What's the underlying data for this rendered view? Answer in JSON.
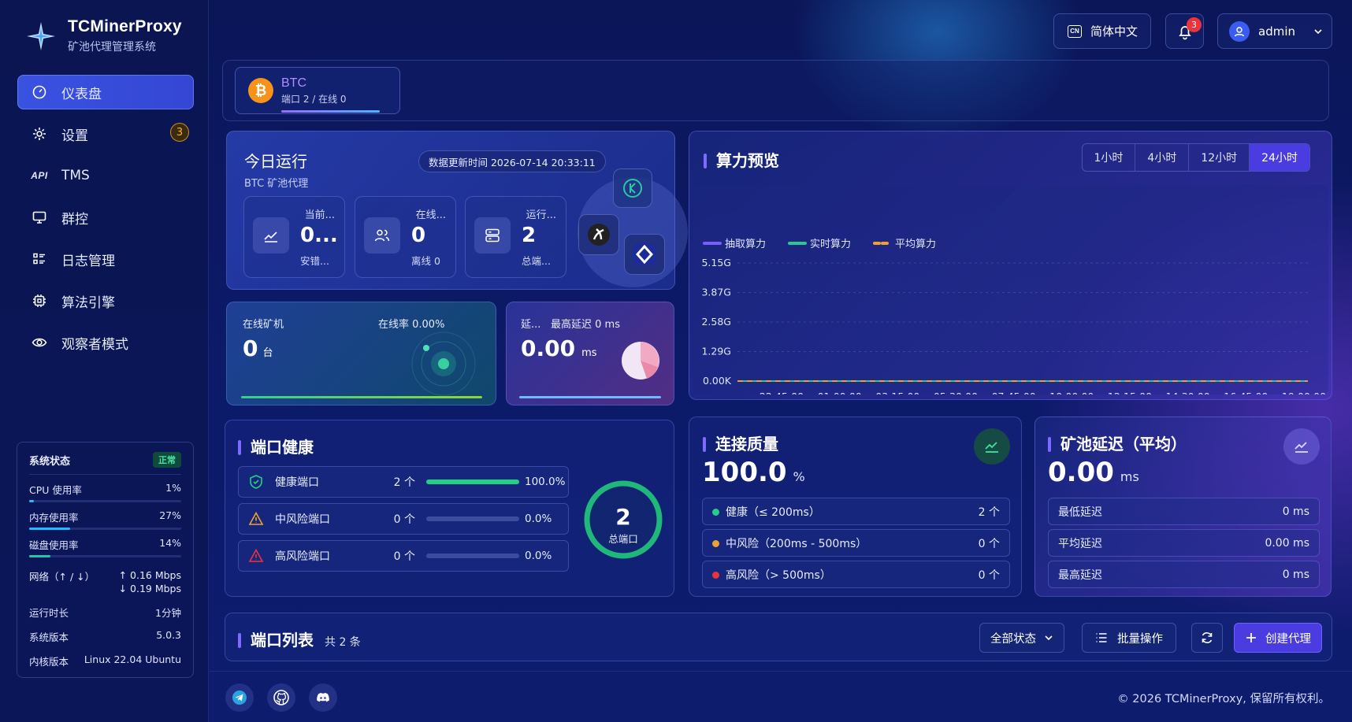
{
  "brand": {
    "name": "TCMinerProxy",
    "subtitle": "矿池代理管理系统"
  },
  "sidebar": {
    "items": [
      {
        "label": "仪表盘",
        "icon": "dashboard-icon",
        "active": true
      },
      {
        "label": "设置",
        "icon": "gear-icon",
        "badge": "3"
      },
      {
        "label": "TMS",
        "icon": "api-icon",
        "icon_text": "API"
      },
      {
        "label": "群控",
        "icon": "monitor-icon"
      },
      {
        "label": "日志管理",
        "icon": "list-icon"
      },
      {
        "label": "算法引擎",
        "icon": "chip-icon"
      },
      {
        "label": "观察者模式",
        "icon": "eye-icon"
      }
    ]
  },
  "system_status": {
    "title": "系统状态",
    "status": "正常",
    "cpu_label": "CPU 使用率",
    "cpu_value": "1%",
    "cpu_pct": 1,
    "mem_label": "内存使用率",
    "mem_value": "27%",
    "mem_pct": 27,
    "disk_label": "磁盘使用率",
    "disk_value": "14%",
    "disk_pct": 14,
    "net_label": "网络（↑ / ↓）",
    "net_up": "↑ 0.16 Mbps",
    "net_down": "↓ 0.19 Mbps",
    "uptime_label": "运行时长",
    "uptime_value": "1分钟",
    "version_label": "系统版本",
    "version_value": "5.0.3",
    "kernel_label": "内核版本",
    "kernel_value": "Linux 22.04 Ubuntu"
  },
  "header": {
    "lang_icon_text": "CN",
    "lang_label": "简体中文",
    "notif_count": "3",
    "user": "admin"
  },
  "coin": {
    "symbol": "₿",
    "name": "BTC",
    "summary": "端口 2 / 在线 0"
  },
  "today": {
    "title": "今日运行",
    "subtitle": "BTC 矿池代理",
    "updated": "数据更新时间 2026-07-14 20:33:11",
    "tiles": [
      {
        "label": "当前...",
        "value": "0...",
        "sub": "安错..."
      },
      {
        "label": "在线...",
        "value": "0",
        "sub": "离线 0"
      },
      {
        "label": "运行...",
        "value": "2",
        "sub": "总端..."
      }
    ]
  },
  "online_miners": {
    "label": "在线矿机",
    "rate": "在线率 0.00%",
    "value": "0",
    "unit": "台"
  },
  "latency_card": {
    "label": "延...",
    "max": "最高延迟 0 ms",
    "value": "0.00",
    "unit": "ms"
  },
  "hashrate": {
    "title": "算力预览",
    "tabs": [
      "1小时",
      "4小时",
      "12小时",
      "24小时"
    ],
    "active_tab": "24小时"
  },
  "chart_data": {
    "type": "line",
    "legend": [
      "抽取算力",
      "实时算力",
      "平均算力"
    ],
    "legend_colors": [
      "#7b5cff",
      "#26c98e",
      "#f0a030"
    ],
    "y_ticks": [
      "5.15G",
      "3.87G",
      "2.58G",
      "1.29G",
      "0.00K"
    ],
    "x": [
      "22:45:00",
      "01:00:00",
      "03:15:00",
      "05:30:00",
      "07:45:00",
      "10:00:00",
      "12:15:00",
      "14:30:00",
      "16:45:00",
      "19:00:00"
    ],
    "series": [
      {
        "name": "抽取算力",
        "values": [
          0,
          0,
          0,
          0,
          0,
          0,
          0,
          0,
          0,
          0
        ]
      },
      {
        "name": "实时算力",
        "values": [
          0,
          0,
          0,
          0,
          0,
          0,
          0,
          0,
          0,
          0
        ]
      },
      {
        "name": "平均算力",
        "values": [
          0,
          0,
          0,
          0,
          0,
          0,
          0,
          0,
          0,
          0
        ]
      }
    ],
    "ylim": [
      0,
      5.15
    ],
    "grid": true,
    "legend_position": "top-left"
  },
  "port_health": {
    "title": "端口健康",
    "rows": [
      {
        "name": "健康端口",
        "count": "2 个",
        "pct": "100.0%",
        "fill": 100,
        "color": "#22d085"
      },
      {
        "name": "中风险端口",
        "count": "0 个",
        "pct": "0.0%",
        "fill": 0,
        "color": "#f0a030"
      },
      {
        "name": "高风险端口",
        "count": "0 个",
        "pct": "0.0%",
        "fill": 0,
        "color": "#e9343c"
      }
    ],
    "ring_value": "2",
    "ring_label": "总端口"
  },
  "quality": {
    "title": "连接质量",
    "value": "100.0",
    "unit": "%",
    "rows": [
      {
        "label": "健康（≤ 200ms）",
        "count": "2 个",
        "color": "#22d085"
      },
      {
        "label": "中风险（200ms - 500ms）",
        "count": "0 个",
        "color": "#f0a030"
      },
      {
        "label": "高风险（> 500ms）",
        "count": "0 个",
        "color": "#e9343c"
      }
    ]
  },
  "pool_latency": {
    "title": "矿池延迟（平均）",
    "value": "0.00",
    "unit": "ms",
    "rows": [
      {
        "label": "最低延迟",
        "value": "0 ms"
      },
      {
        "label": "平均延迟",
        "value": "0.00 ms"
      },
      {
        "label": "最高延迟",
        "value": "0 ms"
      }
    ]
  },
  "port_list": {
    "title": "端口列表",
    "count": "共 2 条",
    "filter": "全部状态",
    "batch": "批量操作",
    "create": "创建代理"
  },
  "footer": {
    "copyright": "© 2026 TCMinerProxy, 保留所有权利。"
  }
}
